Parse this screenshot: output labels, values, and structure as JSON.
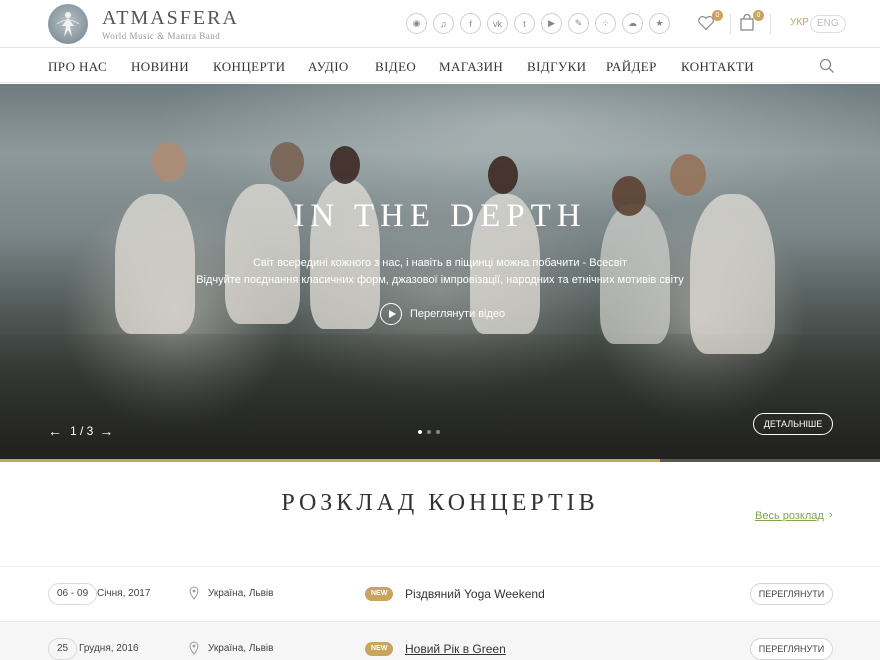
{
  "brand": {
    "title": "ATMASFERA",
    "subtitle": "World Music & Mantra Band"
  },
  "socials": [
    {
      "icon": "music-platform-icon",
      "glyph": "◉"
    },
    {
      "icon": "music-note-icon",
      "glyph": "♫"
    },
    {
      "icon": "facebook-icon",
      "glyph": "f"
    },
    {
      "icon": "vk-icon",
      "glyph": "vk"
    },
    {
      "icon": "twitter-icon",
      "glyph": "t"
    },
    {
      "icon": "youtube-icon",
      "glyph": "▶"
    },
    {
      "icon": "link-icon",
      "glyph": "✎"
    },
    {
      "icon": "community-icon",
      "glyph": "⁘"
    },
    {
      "icon": "soundcloud-icon",
      "glyph": "☁"
    },
    {
      "icon": "star-icon",
      "glyph": "★"
    }
  ],
  "wishlist_count": "0",
  "cart_count": "0",
  "languages": {
    "active": "УКР",
    "other": "ENG"
  },
  "nav": [
    "ПРО НАС",
    "НОВИНИ",
    "КОНЦЕРТИ",
    "АУДІО",
    "ВІДЕО",
    "МАГАЗИН",
    "ВІДГУКИ",
    "РАЙДЕР",
    "КОНТАКТИ"
  ],
  "hero": {
    "title": "IN THE DEPTH",
    "line1": "Світ всередині кожного з нас, і навіть в піщинці можна побачити - Всесвіт",
    "line2": "Відчуйте поєднання класичних форм, джазової імпровізації, народних та етнічних мотивів світу",
    "play_label": "Переглянути відео",
    "slide_counter": "1 / 3",
    "more_label": "ДЕТАЛЬНІШЕ",
    "progress": 0.75,
    "dots_total": 3,
    "dots_active": 1
  },
  "schedule": {
    "title": "РОЗКЛАД КОНЦЕРТІВ",
    "all_link": "Весь розклад",
    "rows": [
      {
        "date": "06 - 09",
        "month": "Січня, 2017",
        "place": "Україна, Львів",
        "badge": "NEW",
        "event": "Різдвяний Yoga Weekend",
        "view": "ПЕРЕГЛЯНУТИ"
      },
      {
        "date": "25",
        "month": "Грудня, 2016",
        "place": "Україна, Львів",
        "badge": "NEW",
        "event": "Новий Рік в Green",
        "view": "ПЕРЕГЛЯНУТИ"
      }
    ]
  },
  "colors": {
    "accent": "#c9a45f",
    "link_green": "#7fa44a"
  }
}
